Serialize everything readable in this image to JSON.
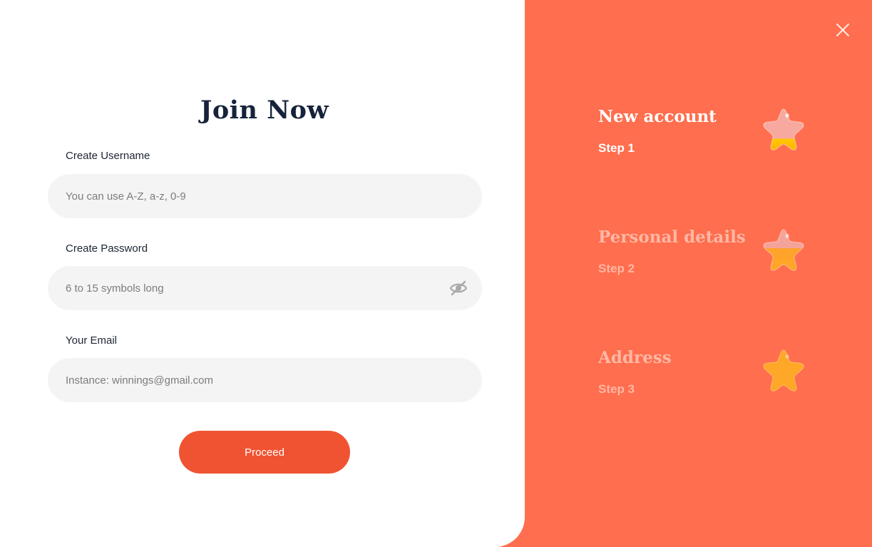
{
  "form": {
    "title": "Join Now",
    "username": {
      "label": "Create Username",
      "placeholder": "You can use A-Z, a-z, 0-9",
      "value": ""
    },
    "password": {
      "label": "Create Password",
      "placeholder": "6 to 15 symbols long",
      "value": "",
      "toggle_icon": "eye-hidden-icon"
    },
    "email": {
      "label": "Your Email",
      "placeholder": "Instance: winnings@gmail.com",
      "value": ""
    },
    "submit_label": "Proceed"
  },
  "steps": [
    {
      "title": "New account",
      "subtitle": "Step 1",
      "state": "active",
      "icon": "star-icon"
    },
    {
      "title": "Personal details",
      "subtitle": "Step 2",
      "state": "inactive",
      "icon": "star-icon"
    },
    {
      "title": "Address",
      "subtitle": "Step 3",
      "state": "inactive",
      "icon": "star-icon"
    }
  ],
  "close_icon": "close-icon",
  "colors": {
    "accent_panel": "#ff6e4e",
    "button": "#f05331",
    "title_text": "#17233b",
    "input_bg": "#f4f4f4",
    "star_fill": "#ffa726",
    "star_pink": "#f4a39a"
  }
}
